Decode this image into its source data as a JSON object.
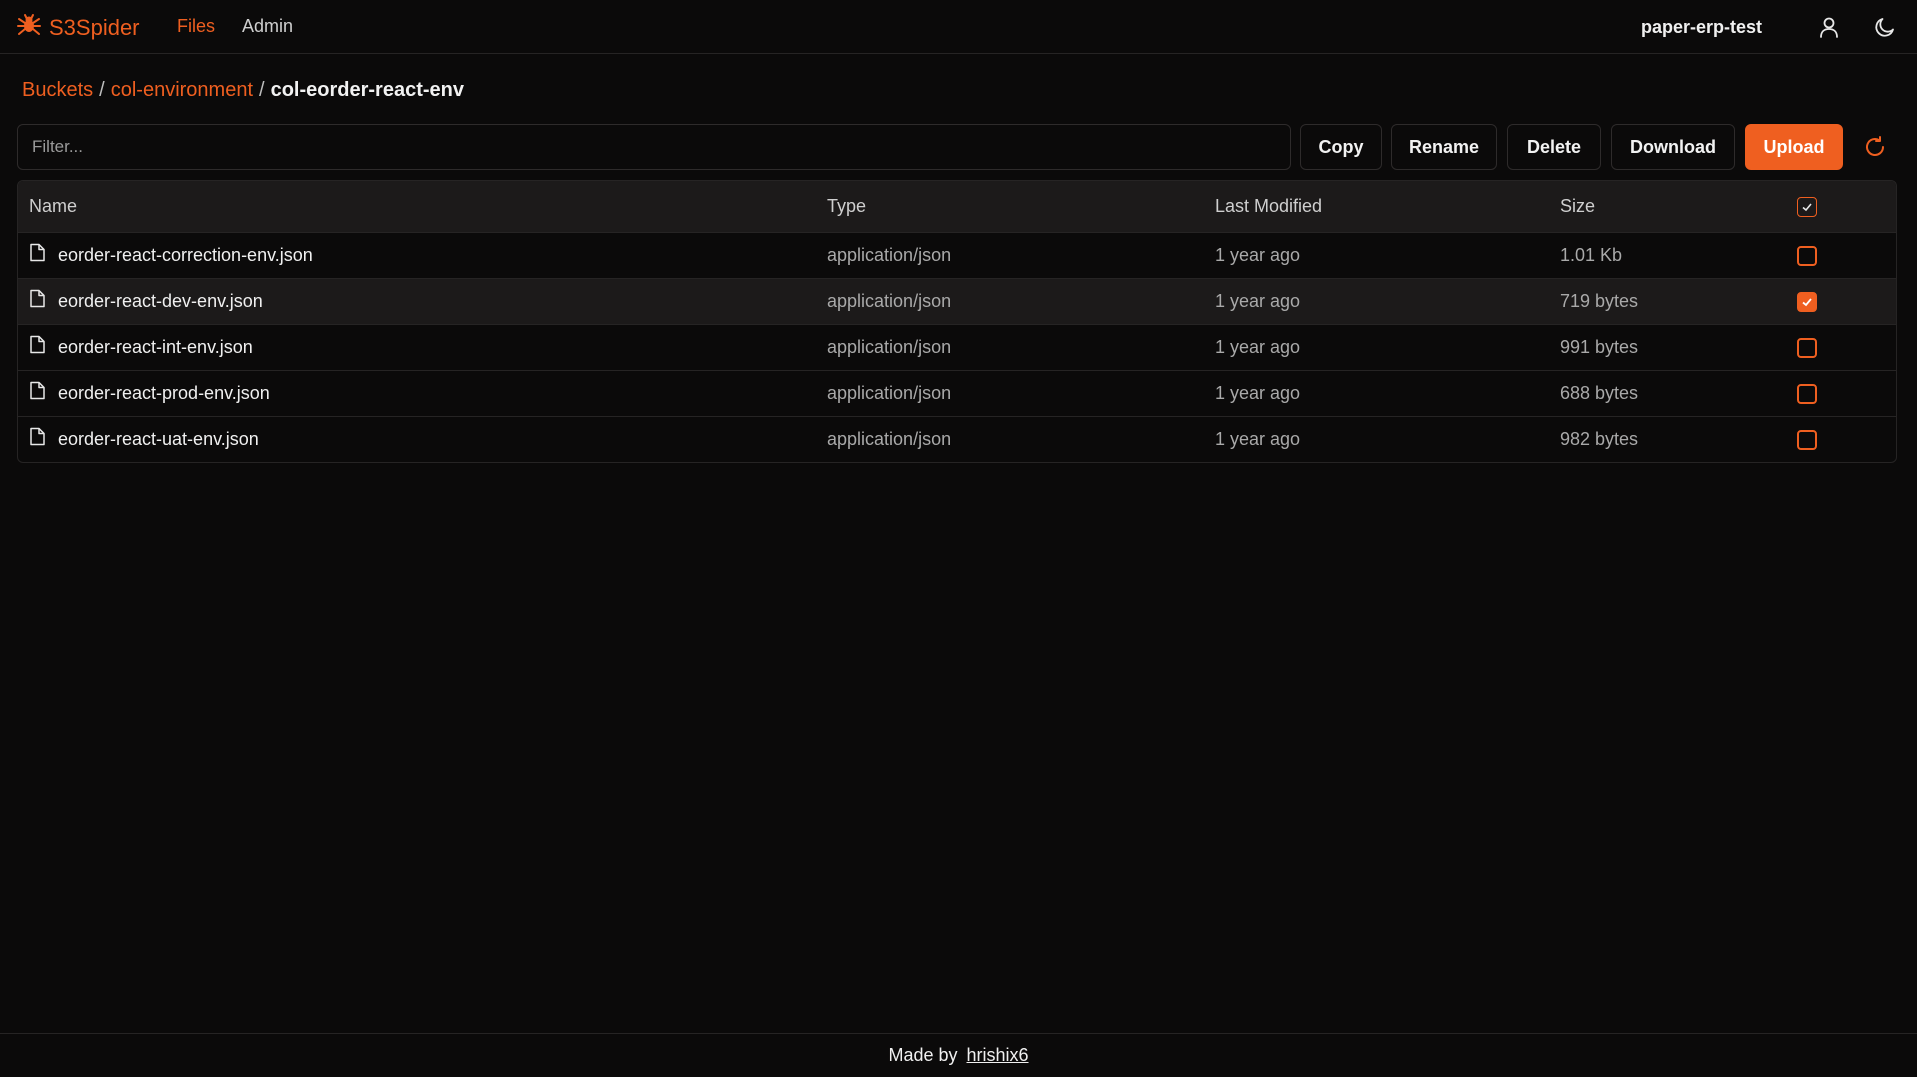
{
  "app": {
    "name": "S3Spider",
    "accent_color": "#ef5f20",
    "logo_icon": "spider-icon"
  },
  "nav": {
    "files_label": "Files",
    "admin_label": "Admin"
  },
  "header": {
    "bucket_name": "paper-erp-test",
    "user_icon": "user-icon",
    "theme_icon": "moon-icon"
  },
  "breadcrumb": {
    "root": "Buckets",
    "separator": "/",
    "level1": "col-environment",
    "current": "col-eorder-react-env"
  },
  "toolbar": {
    "filter_placeholder": "Filter...",
    "filter_value": "",
    "copy_label": "Copy",
    "rename_label": "Rename",
    "delete_label": "Delete",
    "download_label": "Download",
    "upload_label": "Upload",
    "refresh_icon": "refresh-icon"
  },
  "table": {
    "columns": {
      "name": "Name",
      "type": "Type",
      "modified": "Last Modified",
      "size": "Size"
    },
    "select_all_checked": true,
    "rows": [
      {
        "name": "eorder-react-correction-env.json",
        "type": "application/json",
        "modified": "1 year ago",
        "size": "1.01 Kb",
        "checked": false
      },
      {
        "name": "eorder-react-dev-env.json",
        "type": "application/json",
        "modified": "1 year ago",
        "size": "719 bytes",
        "checked": true
      },
      {
        "name": "eorder-react-int-env.json",
        "type": "application/json",
        "modified": "1 year ago",
        "size": "991 bytes",
        "checked": false
      },
      {
        "name": "eorder-react-prod-env.json",
        "type": "application/json",
        "modified": "1 year ago",
        "size": "688 bytes",
        "checked": false
      },
      {
        "name": "eorder-react-uat-env.json",
        "type": "application/json",
        "modified": "1 year ago",
        "size": "982 bytes",
        "checked": false
      }
    ]
  },
  "footer": {
    "made_by": "Made by",
    "author": "hrishix6"
  }
}
